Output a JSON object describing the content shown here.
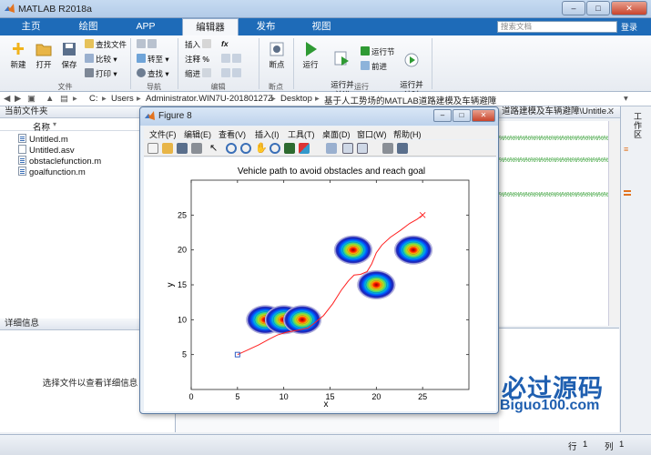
{
  "app": {
    "title": "MATLAB R2018a"
  },
  "tabs": [
    {
      "label": "主页"
    },
    {
      "label": "绘图"
    },
    {
      "label": "APP"
    },
    {
      "label": "编辑器"
    },
    {
      "label": "发布"
    },
    {
      "label": "视图"
    }
  ],
  "search": {
    "placeholder": "搜索文档"
  },
  "login": "登录",
  "ribbon": {
    "file": {
      "new": "新建",
      "open": "打开",
      "save": "保存",
      "find_files": "查找文件",
      "compare": "比较",
      "print": "打印",
      "section": "文件"
    },
    "navigate": {
      "goto": "转至",
      "find": "查找",
      "section": "导航"
    },
    "edit": {
      "insert": "插入",
      "comment": "注释",
      "indent": "缩进",
      "fx": "fx",
      "section": "编辑"
    },
    "breakpoints": {
      "label": "断点",
      "section": "断点"
    },
    "run": {
      "run": "运行",
      "run_advance": "运行并\n前进",
      "run_section": "运行节",
      "advance": "前进",
      "run_time": "运行并\n计时",
      "section": "运行"
    }
  },
  "address": {
    "path": [
      "C:",
      "Users",
      "Administrator.WIN7U-20180127Z",
      "Desktop",
      "基于人工势场的MATLAB道路建模及车辆避障"
    ]
  },
  "left_panel": {
    "title": "当前文件夹",
    "col_name": "名称",
    "files": [
      "Untitled.m",
      "Untitled.asv",
      "obstaclefunction.m",
      "goalfunction.m"
    ],
    "details_title": "详细信息",
    "details_hint": "选择文件以查看详细信息"
  },
  "editor": {
    "tab_title": "道路建模及车辆避障\\Untitle...",
    "comment_line": "%%%%%%%%%%%%%%%%%%%%%%%%%",
    "right_label": "工作区"
  },
  "status": {
    "row_label": "行",
    "row": "1",
    "col_label": "列",
    "col": "1"
  },
  "figure": {
    "title": "Figure 8",
    "menu": [
      "文件(F)",
      "编辑(E)",
      "查看(V)",
      "插入(I)",
      "工具(T)",
      "桌面(D)",
      "窗口(W)",
      "帮助(H)"
    ]
  },
  "chart_data": {
    "type": "line",
    "title": "Vehicle path to avoid obstacles and reach goal",
    "xlabel": "x",
    "ylabel": "y",
    "xlim": [
      0,
      30
    ],
    "ylim": [
      0,
      30
    ],
    "xticks": [
      0,
      5,
      10,
      15,
      20,
      25
    ],
    "yticks": [
      5,
      10,
      15,
      20,
      25
    ],
    "start": [
      5,
      5
    ],
    "goal": [
      25,
      25
    ],
    "path": [
      [
        5,
        5
      ],
      [
        6,
        5.6
      ],
      [
        7.3,
        6.4
      ],
      [
        8.4,
        7.2
      ],
      [
        9.3,
        7.8
      ],
      [
        10.3,
        8.2
      ],
      [
        11.5,
        8.5
      ],
      [
        12.6,
        8.8
      ],
      [
        13.3,
        9.5
      ],
      [
        14.3,
        10.6
      ],
      [
        15.3,
        12.3
      ],
      [
        16.2,
        14.2
      ],
      [
        17,
        15.6
      ],
      [
        17.6,
        16.4
      ],
      [
        18.3,
        16.5
      ],
      [
        19,
        16.9
      ],
      [
        19.5,
        18
      ],
      [
        20,
        19.6
      ],
      [
        20.6,
        20.7
      ],
      [
        21.5,
        21.8
      ],
      [
        22.6,
        22.8
      ],
      [
        23.6,
        23.8
      ],
      [
        24.4,
        24.4
      ],
      [
        25,
        25
      ]
    ],
    "obstacles": [
      [
        8,
        10
      ],
      [
        10,
        10
      ],
      [
        12,
        10
      ],
      [
        17.5,
        20
      ],
      [
        20,
        15
      ],
      [
        24,
        20
      ]
    ]
  }
}
